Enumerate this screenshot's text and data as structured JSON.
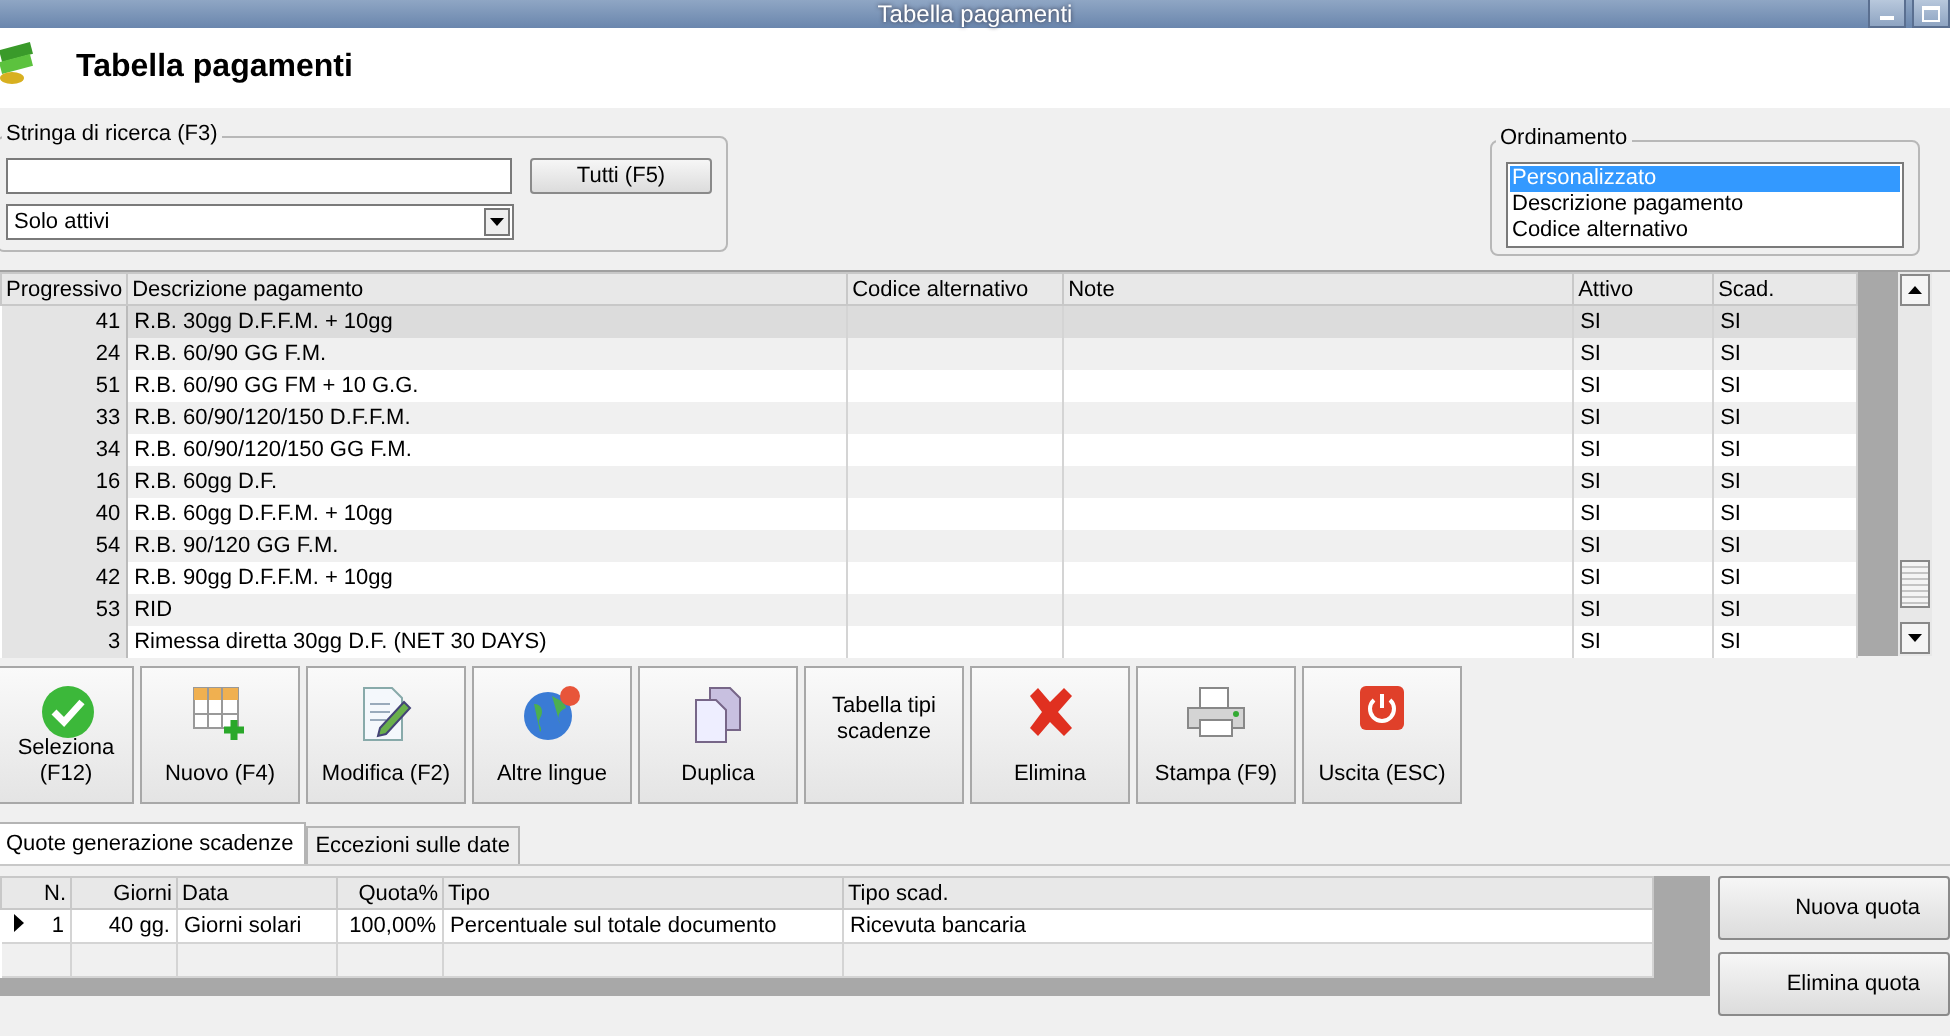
{
  "window": {
    "title": "Tabella pagamenti"
  },
  "header": {
    "title": "Tabella pagamenti"
  },
  "search": {
    "label": "Stringa di ricerca (F3)",
    "button": "Tutti (F5)",
    "filter": "Solo attivi"
  },
  "sorting": {
    "label": "Ordinamento",
    "options": [
      {
        "label": "Personalizzato",
        "selected": true
      },
      {
        "label": "Descrizione pagamento",
        "selected": false
      },
      {
        "label": "Codice alternativo",
        "selected": false
      }
    ]
  },
  "table": {
    "columns": [
      "Progressivo",
      "Descrizione pagamento",
      "Codice alternativo",
      "Note",
      "Attivo",
      "Scad."
    ],
    "rows": [
      {
        "cells": [
          "41",
          "R.B. 30gg D.F.F.M. + 10gg",
          "",
          "",
          "SI",
          "SI"
        ],
        "selected": true
      },
      {
        "cells": [
          "24",
          "R.B. 60/90 GG F.M.",
          "",
          "",
          "SI",
          "SI"
        ],
        "selected": false
      },
      {
        "cells": [
          "51",
          "R.B. 60/90 GG FM + 10 G.G.",
          "",
          "",
          "SI",
          "SI"
        ],
        "selected": false
      },
      {
        "cells": [
          "33",
          "R.B. 60/90/120/150 D.F.F.M.",
          "",
          "",
          "SI",
          "SI"
        ],
        "selected": false
      },
      {
        "cells": [
          "34",
          "R.B. 60/90/120/150 GG F.M.",
          "",
          "",
          "SI",
          "SI"
        ],
        "selected": false
      },
      {
        "cells": [
          "16",
          "R.B. 60gg D.F.",
          "",
          "",
          "SI",
          "SI"
        ],
        "selected": false
      },
      {
        "cells": [
          "40",
          "R.B. 60gg D.F.F.M. + 10gg",
          "",
          "",
          "SI",
          "SI"
        ],
        "selected": false
      },
      {
        "cells": [
          "54",
          "R.B. 90/120 GG F.M.",
          "",
          "",
          "SI",
          "SI"
        ],
        "selected": false
      },
      {
        "cells": [
          "42",
          "R.B. 90gg D.F.F.M. + 10gg",
          "",
          "",
          "SI",
          "SI"
        ],
        "selected": false
      },
      {
        "cells": [
          "53",
          "RID",
          "",
          "",
          "SI",
          "SI"
        ],
        "selected": false
      },
      {
        "cells": [
          "3",
          "Rimessa diretta 30gg D.F. (NET 30 DAYS)",
          "",
          "",
          "SI",
          "SI"
        ],
        "selected": false
      }
    ]
  },
  "toolbar": [
    {
      "label": "Seleziona (F12)"
    },
    {
      "label": "Nuovo (F4)"
    },
    {
      "label": "Modifica (F2)"
    },
    {
      "label": "Altre lingue"
    },
    {
      "label": "Duplica"
    },
    {
      "label": "Tabella tipi scadenze"
    },
    {
      "label": "Elimina"
    },
    {
      "label": "Stampa (F9)"
    },
    {
      "label": "Uscita (ESC)"
    }
  ],
  "tabs": [
    {
      "label": "Quote generazione scadenze",
      "selected": true
    },
    {
      "label": "Eccezioni sulle date",
      "selected": false
    }
  ],
  "quotes": {
    "columns": [
      "N.",
      "Giorni",
      "Data",
      "Quota%",
      "Tipo",
      "Tipo scad."
    ],
    "rows": [
      {
        "cells": [
          "1",
          "40 gg.",
          "Giorni solari",
          "100,00%",
          "Percentuale sul totale documento",
          "Ricevuta bancaria"
        ],
        "selected": true
      }
    ]
  },
  "side_buttons": [
    "Nuova quota",
    "Elimina quota"
  ]
}
